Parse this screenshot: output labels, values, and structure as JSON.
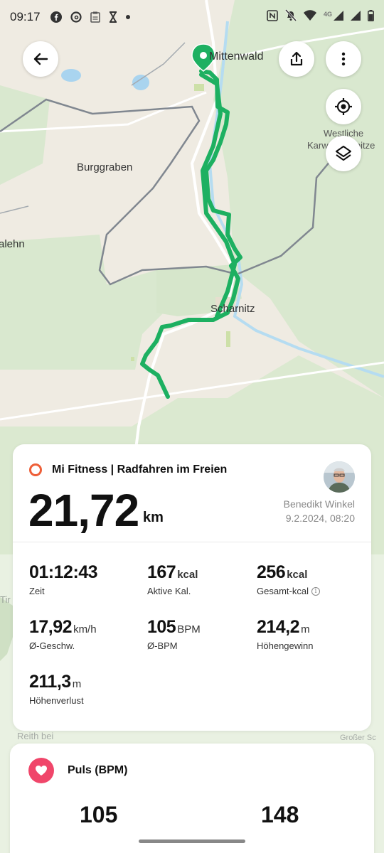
{
  "status_bar": {
    "time": "09:17",
    "network": "4G",
    "left_icons": [
      "facebook-icon",
      "threads-icon",
      "clipboard-icon",
      "hourglass-icon",
      "dot-icon"
    ],
    "right_icons": [
      "nfc-icon",
      "bell-off-icon",
      "wifi-icon",
      "signal-icon",
      "signal-icon",
      "battery-icon"
    ]
  },
  "map": {
    "labels": {
      "town_top": "Mittenwald",
      "burggraben": "Burggraben",
      "lehn": "alehn",
      "scharnitz": "Scharnitz",
      "westliche_1": "Westliche",
      "westliche_2": "Karwendelspitze",
      "tir": "Tir",
      "reith": "Reith bei",
      "grosser": "Großer Sc"
    },
    "route_color": "#1db061"
  },
  "summary": {
    "source_title": "Mi Fitness | Radfahren im Freien",
    "distance_value": "21,72",
    "distance_unit": "km",
    "user_name": "Benedikt Winkel",
    "datetime": "9.2.2024, 08:20",
    "accent_color": "#ee5f38",
    "metrics": {
      "time": {
        "value": "01:12:43",
        "unit": "",
        "label": "Zeit"
      },
      "active_kcal": {
        "value": "167",
        "unit": "kcal",
        "label": "Aktive Kal."
      },
      "total_kcal": {
        "value": "256",
        "unit": "kcal",
        "label": "Gesamt-kcal"
      },
      "avg_speed": {
        "value": "17,92",
        "unit": "km/h",
        "label": "Ø-Geschw."
      },
      "avg_bpm": {
        "value": "105",
        "unit": "BPM",
        "label": "Ø-BPM"
      },
      "ascent": {
        "value": "214,2",
        "unit": "m",
        "label": "Höhengewinn"
      },
      "descent": {
        "value": "211,3",
        "unit": "m",
        "label": "Höhenverlust"
      }
    }
  },
  "heart": {
    "title": "Puls (BPM)",
    "avg": "105",
    "max": "148",
    "color": "#f0466a"
  }
}
